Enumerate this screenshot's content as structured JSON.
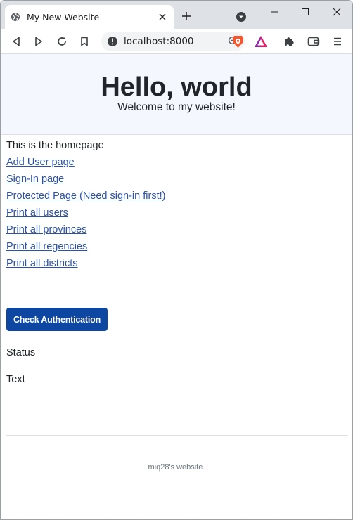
{
  "browser": {
    "tab": {
      "title": "My New Website"
    },
    "address_bar": {
      "url": "localhost:8000"
    }
  },
  "page": {
    "hero": {
      "title": "Hello, world",
      "subtitle": "Welcome to my website!"
    },
    "intro": "This is the homepage",
    "links": [
      "Add User page",
      "Sign-In page",
      "Protected Page (Need sign-in first!)",
      "Print all users",
      "Print all provinces",
      "Print all regencies",
      "Print all districts"
    ],
    "auth_button_label": "Check Authentication",
    "status_label": "Status",
    "text_label": "Text",
    "footer": "miq28's website."
  },
  "colors": {
    "hero_bg": "#f4f7fd",
    "link": "#2a52a8",
    "button_bg": "#0d47a1",
    "brave_orange": "#fb542b"
  },
  "icons": [
    "globe-icon",
    "close-icon",
    "plus-icon",
    "tab-search-icon",
    "minimize-icon",
    "maximize-icon",
    "window-close-icon",
    "back-icon",
    "forward-icon",
    "reload-icon",
    "bookmark-icon",
    "info-icon",
    "zoom-icon",
    "brave-shield-icon",
    "brave-rewards-icon",
    "extensions-icon",
    "wallet-icon",
    "menu-icon"
  ]
}
